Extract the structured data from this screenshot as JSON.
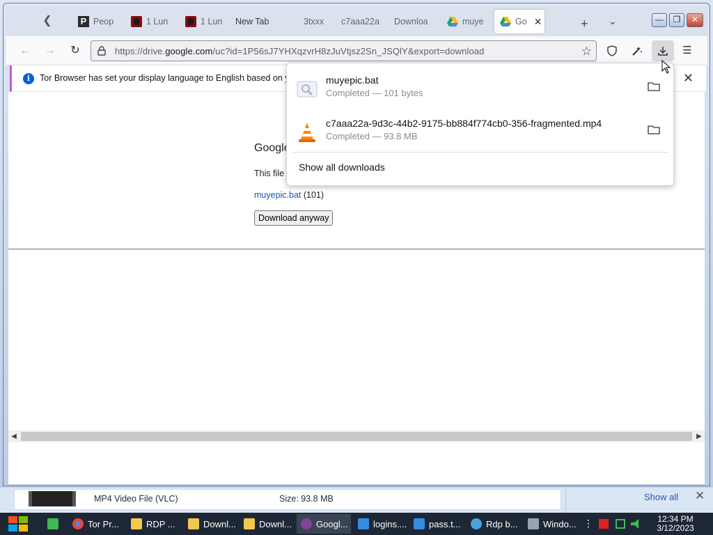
{
  "tabs": [
    {
      "label": "Peop",
      "icon": "p-icon"
    },
    {
      "label": "1 Lun",
      "icon": "red-mask-icon"
    },
    {
      "label": "1 Lun",
      "icon": "red-mask-icon"
    },
    {
      "label": "New Tab",
      "icon": ""
    },
    {
      "label": "3txxx",
      "icon": ""
    },
    {
      "label": "c7aaa22a",
      "icon": ""
    },
    {
      "label": "Downloa",
      "icon": ""
    },
    {
      "label": "muye",
      "icon": "google-drive-icon"
    },
    {
      "label": "Go",
      "icon": "google-drive-icon",
      "active": true
    }
  ],
  "url": {
    "prefix": "https://drive.",
    "host": "google.com",
    "suffix": "/uc?id=1P56sJ7YHXqzvrH8zJuVtjsz2Sn_JSQlY&export=download"
  },
  "infobar": {
    "text": "Tor Browser has set your display language to English based on y"
  },
  "page": {
    "title": "Google",
    "line": "This file",
    "file_link": "muyepic.bat",
    "file_size": "(101)",
    "download_button": "Download anyway"
  },
  "downloads": {
    "items": [
      {
        "name": "muyepic.bat",
        "status": "Completed — 101 bytes",
        "icon": "bat-file-icon"
      },
      {
        "name": "c7aaa22a-9d3c-44b2-9175-bb884f774cb0-356-fragmented.mp4",
        "status": "Completed — 93.8 MB",
        "icon": "vlc-cone-icon"
      }
    ],
    "show_all": "Show all downloads"
  },
  "details_strip": {
    "type": "MP4 Video File (VLC)",
    "size": "Size: 93.8 MB",
    "show_all": "Show all"
  },
  "taskbar": {
    "items": [
      {
        "label": "",
        "icon": "notepadpp-icon",
        "color": "#3fb950"
      },
      {
        "label": "Tor Pr...",
        "icon": "chrome-icon",
        "color": "#e8453c"
      },
      {
        "label": "RDP ...",
        "icon": "folder-icon",
        "color": "#f2c94c"
      },
      {
        "label": "Downl...",
        "icon": "folder-icon",
        "color": "#f2c94c"
      },
      {
        "label": "Downl...",
        "icon": "folder-icon",
        "color": "#f2c94c"
      },
      {
        "label": "Googl...",
        "icon": "tor-browser-icon",
        "color": "#7d4698"
      },
      {
        "label": "logins....",
        "icon": "vscode-icon",
        "color": "#2f8de4"
      },
      {
        "label": "pass.t...",
        "icon": "vscode-icon",
        "color": "#2f8de4"
      },
      {
        "label": "Rdp b...",
        "icon": "globe-icon",
        "color": "#4aa3df"
      },
      {
        "label": "Windo...",
        "icon": "monitor-icon",
        "color": "#9aa4b0"
      }
    ],
    "time": "12:34 PM",
    "date": "3/12/2023"
  }
}
